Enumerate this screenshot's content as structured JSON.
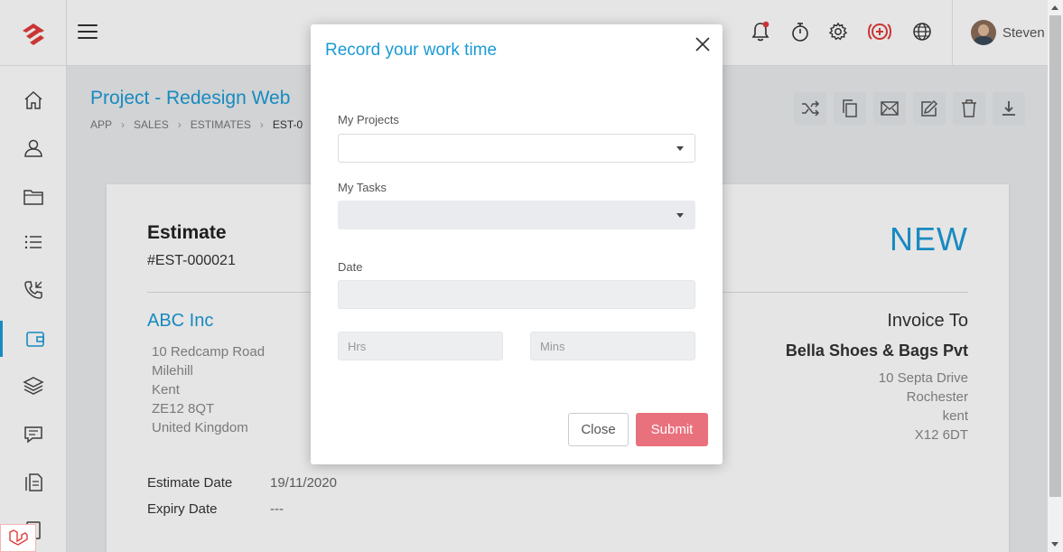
{
  "topbar": {
    "user_name": "Steven",
    "icons": [
      "bell-icon",
      "stopwatch-icon",
      "gear-icon",
      "add-circle-icon",
      "globe-icon"
    ],
    "brand_color": "#e33a3a",
    "accent_color": "#1a9ad6"
  },
  "sidebar": {
    "items": [
      "home-icon",
      "users-icon",
      "folder-icon",
      "list-icon",
      "phone-icon",
      "wallet-icon",
      "layers-icon",
      "chat-icon",
      "documents-icon",
      "tablet-icon"
    ],
    "active_index": 5
  },
  "page": {
    "title": "Project - Redesign Web",
    "breadcrumb": [
      "APP",
      "SALES",
      "ESTIMATES",
      "EST-0"
    ],
    "actions": [
      "shuffle-icon",
      "copy-icon",
      "email-icon",
      "edit-icon",
      "trash-icon",
      "download-icon"
    ]
  },
  "estimate": {
    "heading": "Estimate",
    "number": "#EST-000021",
    "status": "NEW",
    "company": "ABC Inc",
    "company_address": [
      "10 Redcamp Road",
      "Milehill",
      "Kent",
      "ZE12 8QT",
      "United Kingdom"
    ],
    "invoice_to_label": "Invoice To",
    "client": "Bella Shoes & Bags Pvt",
    "client_address": [
      "10 Septa Drive",
      "Rochester",
      "kent",
      "X12 6DT"
    ],
    "estimate_date_label": "Estimate Date",
    "estimate_date": "19/11/2020",
    "expiry_date_label": "Expiry Date",
    "expiry_date": "---"
  },
  "modal": {
    "title": "Record your work time",
    "projects_label": "My Projects",
    "projects_value": "",
    "tasks_label": "My Tasks",
    "tasks_value": "",
    "date_label": "Date",
    "date_value": "",
    "hrs_placeholder": "Hrs",
    "mins_placeholder": "Mins",
    "close_label": "Close",
    "submit_label": "Submit",
    "submit_color": "#e9707d"
  }
}
